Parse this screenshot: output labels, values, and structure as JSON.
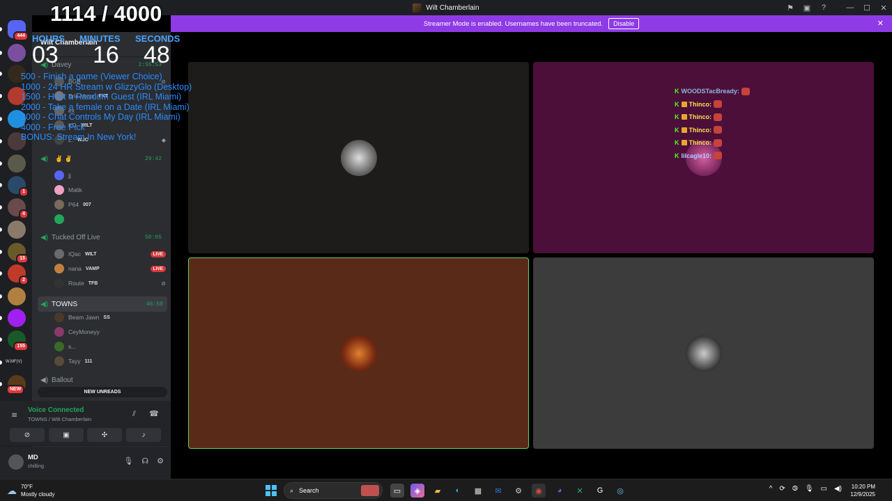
{
  "window": {
    "title": "Wilt Chamberlain"
  },
  "banner": {
    "text": "Streamer Mode is enabled. Usernames have been truncated.",
    "button": "Disable"
  },
  "servers": [
    {
      "badge": "444",
      "color": "#5865f2"
    },
    {
      "badge": "",
      "color": "#7a4fa0"
    },
    {
      "badge": "",
      "color": "#332a1d"
    },
    {
      "badge": "",
      "color": "#b23a2f"
    },
    {
      "badge": "",
      "color": "#1f90e0"
    },
    {
      "badge": "",
      "color": "#4a3a3a"
    },
    {
      "badge": "",
      "color": "#5a5a4a"
    },
    {
      "badge": "1",
      "color": "#2a4a6a"
    },
    {
      "badge": "4",
      "color": "#6a4a4a"
    },
    {
      "badge": "",
      "color": "#8a7a6a"
    },
    {
      "badge": "15",
      "color": "#6a5a2a"
    },
    {
      "badge": "2",
      "color": "#c03a2a"
    },
    {
      "badge": "",
      "color": "#b08040"
    },
    {
      "badge": "",
      "color": "#a020f0"
    },
    {
      "badge": "155",
      "color": "#1a5a2a"
    },
    {
      "badge": "",
      "color": "#3a3a5a",
      "text": "W.MF(V)"
    },
    {
      "badge": "NEW",
      "color": "#5a3a1a"
    }
  ],
  "channels": {
    "header": "Wilt Chamberlain",
    "voice": [
      {
        "name": "Davey",
        "time": "2:55:53",
        "users": [
          {
            "name": "BGB",
            "tag": ""
          },
          {
            "name": "Eric Mays",
            "tag": "FKT"
          },
          {
            "name": "ex",
            "tag": ""
          },
          {
            "name": "KD",
            "tag": "WILT"
          },
          {
            "name": "L.",
            "tag": "WJC"
          }
        ]
      },
      {
        "name": "",
        "time": "29:42",
        "users": [
          {
            "name": "jj",
            "tag": ""
          },
          {
            "name": "Malik",
            "tag": ""
          },
          {
            "name": "P64",
            "tag": "007"
          },
          {
            "name": "",
            "tag": ""
          }
        ]
      },
      {
        "name": "Tucked Off Live",
        "time": "50:05",
        "users": [
          {
            "name": "IQac",
            "tag": "WILT",
            "live": "LIVE"
          },
          {
            "name": "nana",
            "tag": "VAMP",
            "live": "LIVE"
          },
          {
            "name": "Route",
            "tag": "TFB"
          }
        ]
      },
      {
        "name": "TOWNS",
        "time": "46:50",
        "users": [
          {
            "name": "Beam Jawn",
            "tag": "SS"
          },
          {
            "name": "CeyMoneyy",
            "tag": ""
          },
          {
            "name": "s...",
            "tag": ""
          },
          {
            "name": "Tayy",
            "tag": "111"
          }
        ]
      },
      {
        "name": "Ballout",
        "time": "",
        "users": []
      }
    ],
    "new_unreads": "NEW UNREADS"
  },
  "voice_panel": {
    "status": "Voice Connected",
    "sub": "TOWNS / Wilt Chamberlain"
  },
  "user_panel": {
    "name": "MD",
    "status": "chilling"
  },
  "overlay": {
    "counter": "1114 / 4000",
    "labels": {
      "h": "HOURS",
      "m": "MINUTES",
      "s": "SECONDS"
    },
    "hours": "03",
    "minutes": "16",
    "seconds": "48",
    "goals": [
      "500 - Finish a game (Viewer Choice)",
      "1000 - 24 HR Stream w GlizzyGlo (Desktop)",
      "1500 - Host a Random Guest (IRL Miami)",
      "2000 - Take a female on a Date (IRL Miami)",
      "3000 - Chat Controls My Day (IRL Miami)",
      "4000 - Free Pick",
      "BONUS: Stream In New York!"
    ]
  },
  "chat": {
    "lines": [
      {
        "name": "WOODSTacBready:",
        "color": "#8fb8d8"
      },
      {
        "name": "Thinco:",
        "color": "#ffe04d"
      },
      {
        "name": "Thinco:",
        "color": "#ffe04d"
      },
      {
        "name": "Thinco:",
        "color": "#ffe04d"
      },
      {
        "name": "Thinco:",
        "color": "#ffe04d"
      },
      {
        "name": "lilcagle10:",
        "color": "#b8c8ff"
      }
    ]
  },
  "tiles": [
    {
      "bg": "#1e1c1a",
      "border": ""
    },
    {
      "bg": "#4b0f3a",
      "border": ""
    },
    {
      "bg": "#5a2a18",
      "border": "#5fd35f"
    },
    {
      "bg": "#3c3c3c",
      "border": ""
    }
  ],
  "taskbar": {
    "temp": "70°F",
    "weather": "Mostly cloudy",
    "search": "Search",
    "time": "10:20 PM",
    "date": "12/9/2025"
  }
}
